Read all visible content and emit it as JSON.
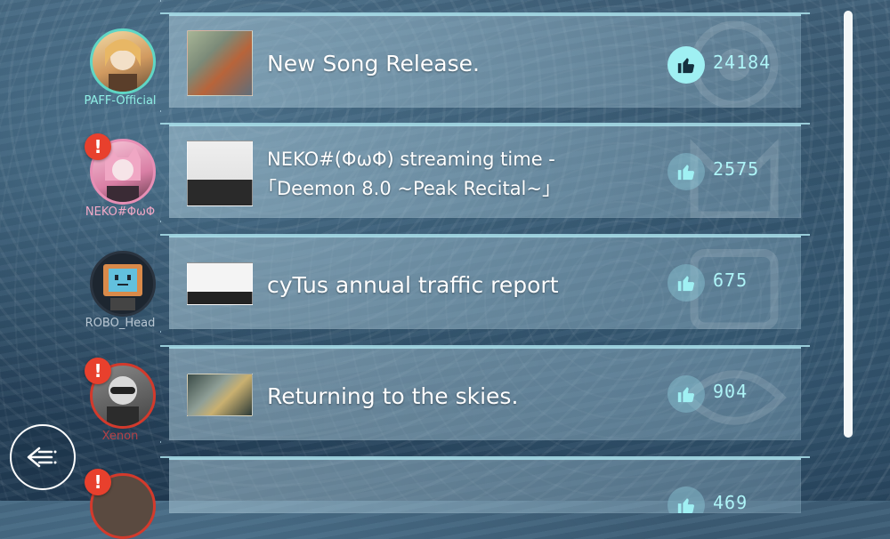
{
  "posts": [
    {
      "username": "PAFF-Official",
      "username_color": "#8ff0e6",
      "avatar_ring": "#5fd6c5",
      "title_line1": "New Song Release.",
      "title_line2": "",
      "likes": "24184",
      "liked": true,
      "has_alert": false,
      "thumb_colors": [
        "#8e9a7a",
        "#c86a3c",
        "#6b7a87"
      ]
    },
    {
      "username": "NEKO#ΦωΦ",
      "username_color": "#f2a9c7",
      "avatar_ring": "#e78fb5",
      "title_line1": "NEKO#(ΦωΦ) streaming time -",
      "title_line2": "「Deemon 8.0 ~Peak Recital~」",
      "likes": "2575",
      "liked": false,
      "has_alert": true,
      "thumb_colors": [
        "#e8e8e8",
        "#2b2b2b",
        "#c44"
      ]
    },
    {
      "username": "ROBO_Head",
      "username_color": "#b9c7d3",
      "avatar_ring": "#2a3440",
      "title_line1": "cyTus annual traffic report",
      "title_line2": "",
      "likes": "675",
      "liked": false,
      "has_alert": false,
      "thumb_colors": [
        "#f2f2f2",
        "#333",
        "#888"
      ]
    },
    {
      "username": "Xenon",
      "username_color": "#e04040",
      "avatar_ring": "#d33a2c",
      "title_line1": "Returning to the skies.",
      "title_line2": "",
      "likes": "904",
      "liked": false,
      "has_alert": true,
      "thumb_colors": [
        "#3c4f4a",
        "#9aa7a0",
        "#c9b070"
      ]
    }
  ],
  "partial_post": {
    "likes": "469"
  }
}
